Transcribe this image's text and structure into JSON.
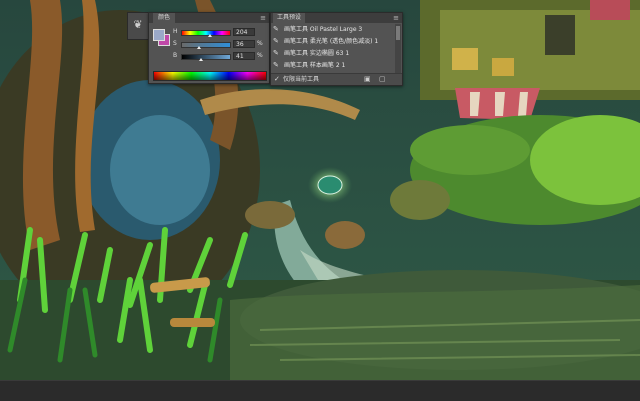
{
  "color_panel": {
    "title": "颜色",
    "foreground_color": "#9aa8c8",
    "background_color": "#c048a8",
    "sliders": [
      {
        "label": "H",
        "value": "204",
        "unit": "",
        "fraction": 0.57
      },
      {
        "label": "S",
        "value": "36",
        "unit": "%",
        "fraction": 0.36
      },
      {
        "label": "B",
        "value": "41",
        "unit": "%",
        "fraction": 0.41
      }
    ]
  },
  "presets_panel": {
    "title": "工具预设",
    "items": [
      {
        "label": "画笔工具 Oil Pastel Large 3"
      },
      {
        "label": "画笔工具 柔光笔 (透色/颜色减淡) 1"
      },
      {
        "label": "画笔工具 实边椭圆 63 1"
      },
      {
        "label": "画笔工具 样本画笔 2 1"
      }
    ],
    "footer_label": "仅限当前工具"
  },
  "icons": {
    "mini_toolbar": "brush-preset-icon",
    "preset_brush": "brush-icon",
    "footer_check": "check-icon",
    "new_preset": "new-preset-icon",
    "delete_preset": "trash-icon"
  }
}
